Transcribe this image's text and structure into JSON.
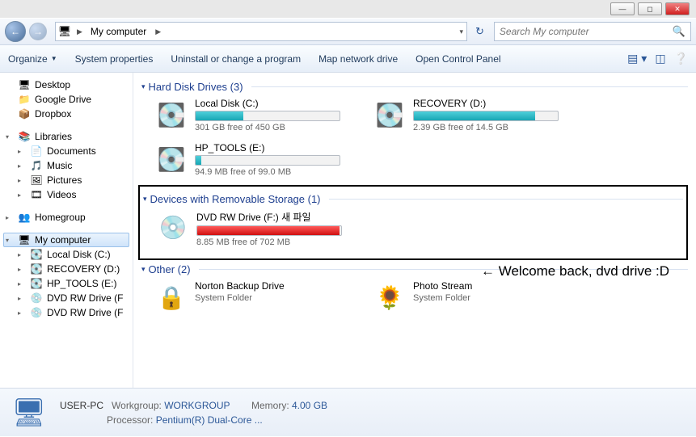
{
  "window_controls": {
    "min": "—",
    "max": "◻",
    "close": "✕"
  },
  "breadcrumb": {
    "location": "My computer"
  },
  "search": {
    "placeholder": "Search My computer"
  },
  "toolbar": {
    "organize": "Organize",
    "system_properties": "System properties",
    "uninstall": "Uninstall or change a program",
    "map_drive": "Map network drive",
    "control_panel": "Open Control Panel"
  },
  "sidebar": {
    "favorites": [
      {
        "icon": "🖥",
        "label": "Desktop"
      },
      {
        "icon": "📁",
        "label": "Google Drive"
      },
      {
        "icon": "📦",
        "label": "Dropbox"
      }
    ],
    "libraries_label": "Libraries",
    "libraries": [
      {
        "icon": "📄",
        "label": "Documents"
      },
      {
        "icon": "🎵",
        "label": "Music"
      },
      {
        "icon": "🖼",
        "label": "Pictures"
      },
      {
        "icon": "🎞",
        "label": "Videos"
      }
    ],
    "homegroup_label": "Homegroup",
    "computer_label": "My computer",
    "drives": [
      {
        "icon": "💽",
        "label": "Local Disk (C:)"
      },
      {
        "icon": "💽",
        "label": "RECOVERY (D:)"
      },
      {
        "icon": "💽",
        "label": "HP_TOOLS (E:)"
      },
      {
        "icon": "💿",
        "label": "DVD RW Drive (F"
      },
      {
        "icon": "💿",
        "label": "DVD RW Drive (F"
      }
    ]
  },
  "groups": {
    "hdd": {
      "header": "Hard Disk Drives (3)",
      "items": [
        {
          "name": "Local Disk (C:)",
          "free": "301 GB free of 450 GB",
          "fill_pct": 33
        },
        {
          "name": "RECOVERY (D:)",
          "free": "2.39 GB free of 14.5 GB",
          "fill_pct": 84
        },
        {
          "name": "HP_TOOLS (E:)",
          "free": "94.9 MB free of 99.0 MB",
          "fill_pct": 4
        }
      ]
    },
    "removable": {
      "header": "Devices with Removable Storage (1)",
      "items": [
        {
          "name": "DVD RW Drive (F:) 새 파일",
          "free": "8.85 MB free of 702 MB",
          "fill_pct": 99,
          "red": true
        }
      ]
    },
    "other": {
      "header": "Other (2)",
      "items": [
        {
          "name": "Norton Backup Drive",
          "sub": "System Folder",
          "icon": "🔒"
        },
        {
          "name": "Photo Stream",
          "sub": "System Folder",
          "icon": "🌻"
        }
      ]
    }
  },
  "annotation": "← Welcome back, dvd drive :D",
  "status": {
    "name": "USER-PC",
    "workgroup_label": "Workgroup:",
    "workgroup": "WORKGROUP",
    "processor_label": "Processor:",
    "processor": "Pentium(R) Dual-Core ...",
    "memory_label": "Memory:",
    "memory": "4.00 GB"
  }
}
